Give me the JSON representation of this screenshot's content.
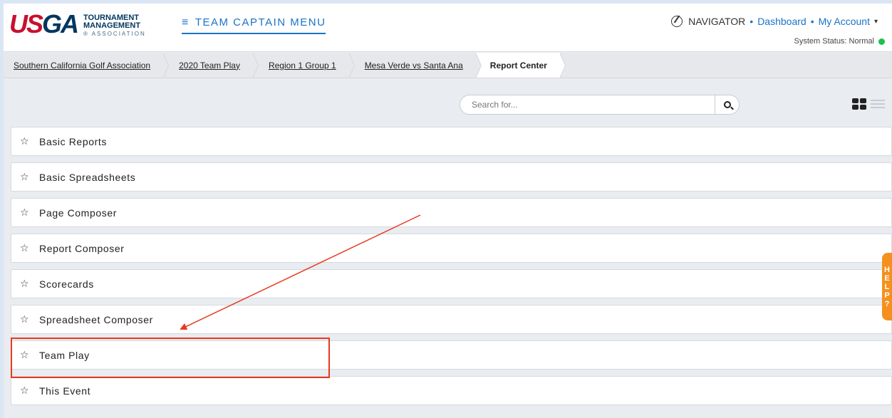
{
  "logo": {
    "usga_us": "US",
    "usga_ga": "GA",
    "line1": "TOURNAMENT",
    "line2": "MANAGEMENT",
    "line3": "® ASSOCIATION"
  },
  "captain_menu": {
    "label": "TEAM CAPTAIN MENU",
    "icon": "hamburger-icon"
  },
  "topnav": {
    "navigator": "NAVIGATOR",
    "dashboard": "Dashboard",
    "account": "My Account",
    "separator": "•",
    "caret": "▾"
  },
  "status": {
    "label": "System Status: Normal",
    "color": "#1fbf4f"
  },
  "breadcrumb": [
    {
      "label": "Southern California Golf Association"
    },
    {
      "label": "2020 Team Play"
    },
    {
      "label": "Region 1 Group 1"
    },
    {
      "label": "Mesa Verde vs Santa Ana"
    },
    {
      "label": "Report Center"
    }
  ],
  "search": {
    "placeholder": "Search for...",
    "value": ""
  },
  "reports": [
    {
      "label": "Basic Reports"
    },
    {
      "label": "Basic Spreadsheets"
    },
    {
      "label": "Page Composer"
    },
    {
      "label": "Report Composer"
    },
    {
      "label": "Scorecards"
    },
    {
      "label": "Spreadsheet Composer"
    },
    {
      "label": "Team Play"
    },
    {
      "label": "This Event"
    }
  ],
  "star_glyph": "☆",
  "help": {
    "letters": [
      "H",
      "E",
      "L",
      "P",
      "?"
    ],
    "color": "#f5901e"
  },
  "annotation": {
    "color": "#e8391f",
    "highlighted_item": "Team Play"
  }
}
